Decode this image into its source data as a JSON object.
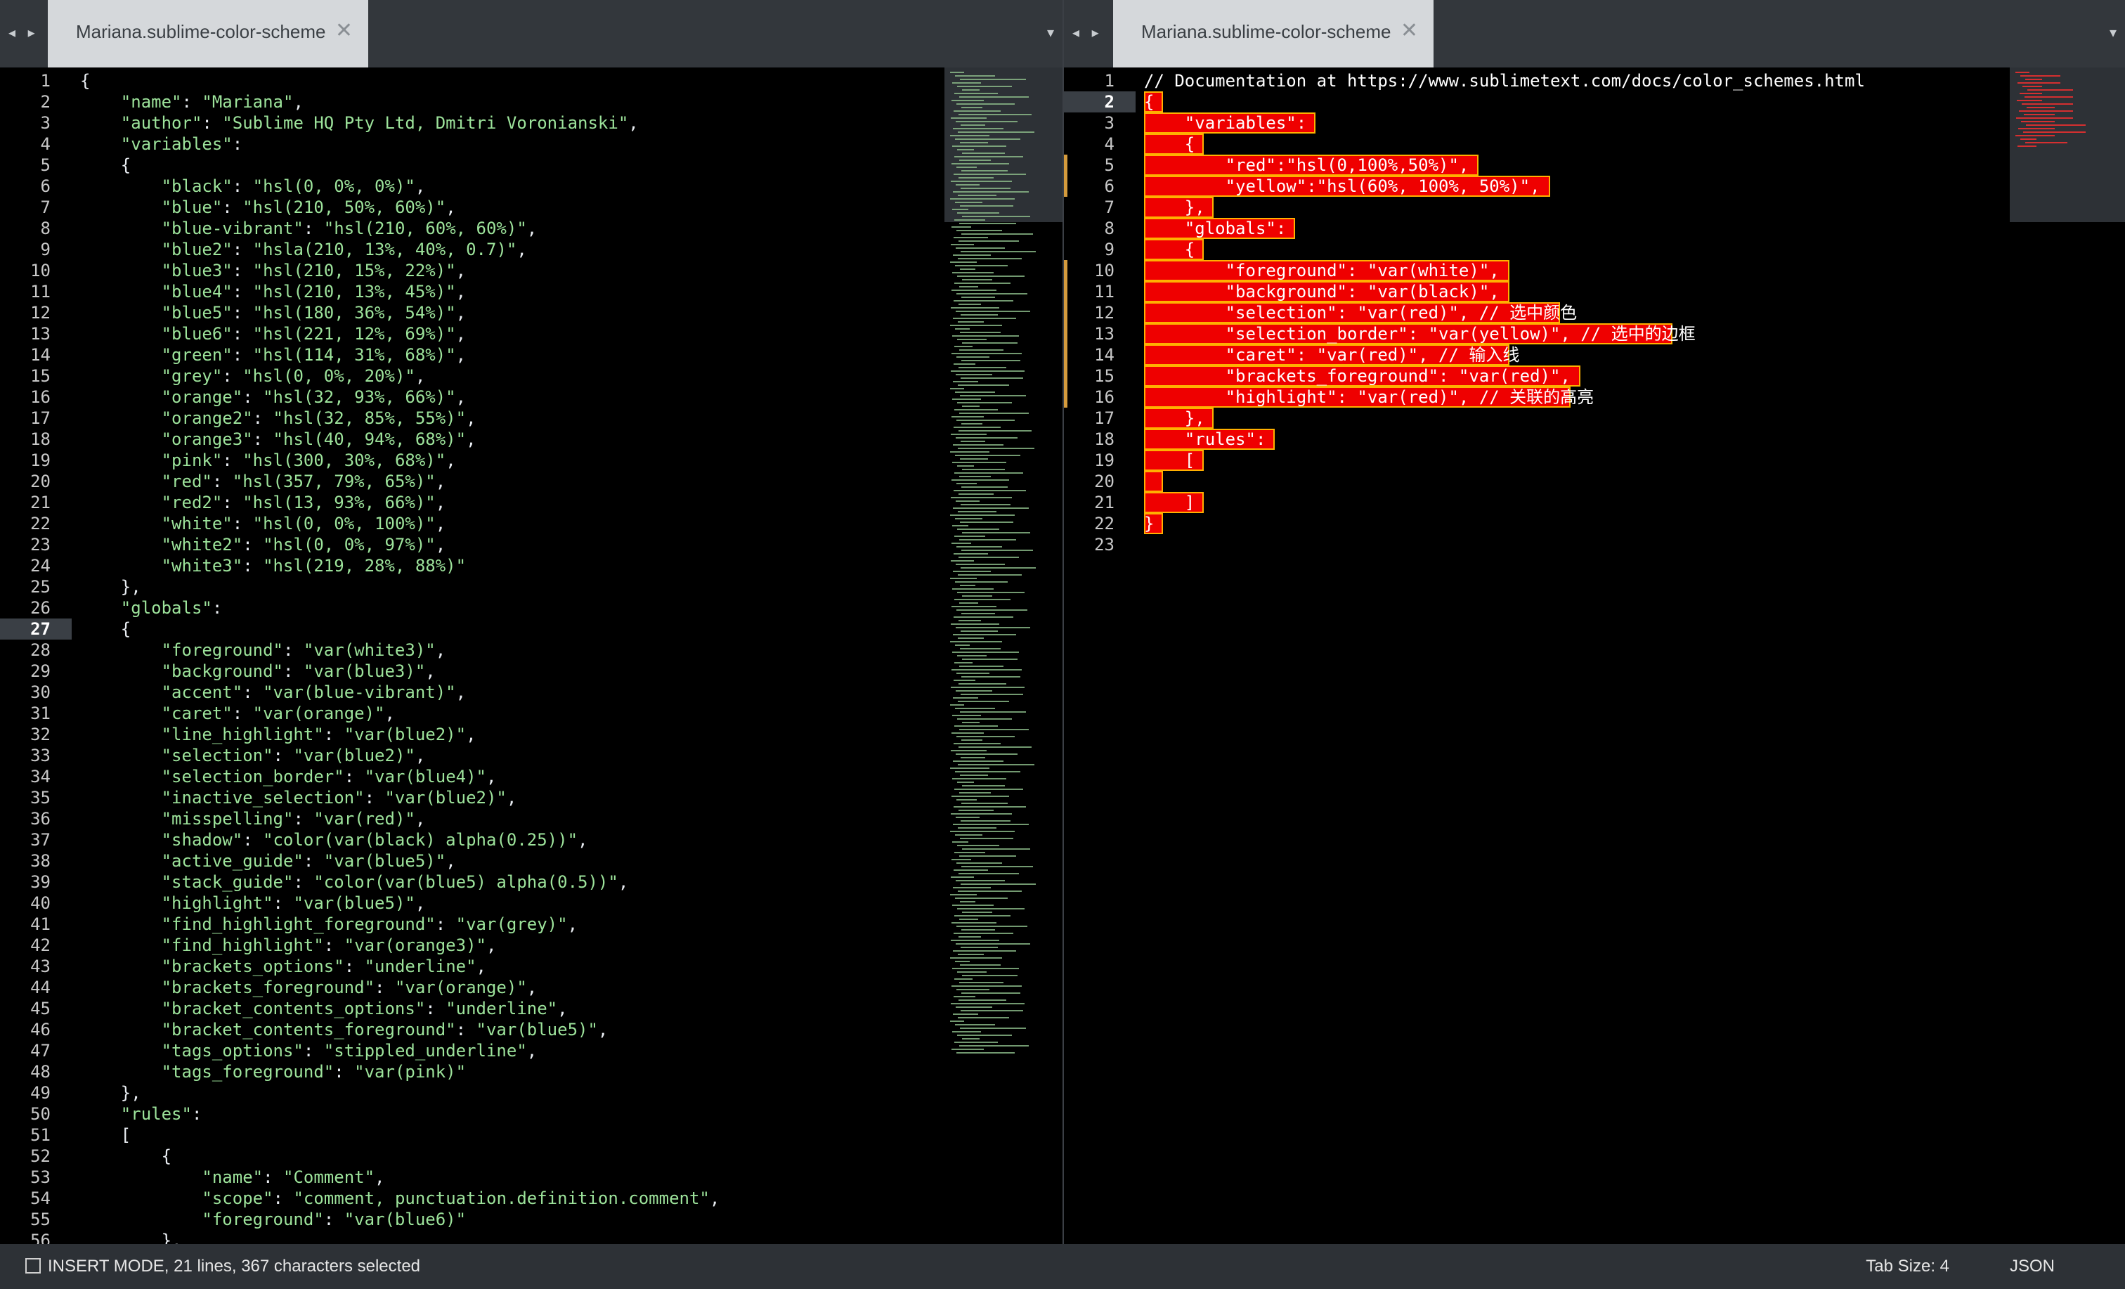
{
  "tab_title": "Mariana.sublime-color-scheme",
  "left_code": [
    {
      "n": "1",
      "t": "{"
    },
    {
      "n": "2",
      "t": "    \"name\": \"Mariana\","
    },
    {
      "n": "3",
      "t": "    \"author\": \"Sublime HQ Pty Ltd, Dmitri Voronianski\","
    },
    {
      "n": "4",
      "t": "    \"variables\":"
    },
    {
      "n": "5",
      "t": "    {"
    },
    {
      "n": "6",
      "t": "        \"black\": \"hsl(0, 0%, 0%)\","
    },
    {
      "n": "7",
      "t": "        \"blue\": \"hsl(210, 50%, 60%)\","
    },
    {
      "n": "8",
      "t": "        \"blue-vibrant\": \"hsl(210, 60%, 60%)\","
    },
    {
      "n": "9",
      "t": "        \"blue2\": \"hsla(210, 13%, 40%, 0.7)\","
    },
    {
      "n": "10",
      "t": "        \"blue3\": \"hsl(210, 15%, 22%)\","
    },
    {
      "n": "11",
      "t": "        \"blue4\": \"hsl(210, 13%, 45%)\","
    },
    {
      "n": "12",
      "t": "        \"blue5\": \"hsl(180, 36%, 54%)\","
    },
    {
      "n": "13",
      "t": "        \"blue6\": \"hsl(221, 12%, 69%)\","
    },
    {
      "n": "14",
      "t": "        \"green\": \"hsl(114, 31%, 68%)\","
    },
    {
      "n": "15",
      "t": "        \"grey\": \"hsl(0, 0%, 20%)\","
    },
    {
      "n": "16",
      "t": "        \"orange\": \"hsl(32, 93%, 66%)\","
    },
    {
      "n": "17",
      "t": "        \"orange2\": \"hsl(32, 85%, 55%)\","
    },
    {
      "n": "18",
      "t": "        \"orange3\": \"hsl(40, 94%, 68%)\","
    },
    {
      "n": "19",
      "t": "        \"pink\": \"hsl(300, 30%, 68%)\","
    },
    {
      "n": "20",
      "t": "        \"red\": \"hsl(357, 79%, 65%)\","
    },
    {
      "n": "21",
      "t": "        \"red2\": \"hsl(13, 93%, 66%)\","
    },
    {
      "n": "22",
      "t": "        \"white\": \"hsl(0, 0%, 100%)\","
    },
    {
      "n": "23",
      "t": "        \"white2\": \"hsl(0, 0%, 97%)\","
    },
    {
      "n": "24",
      "t": "        \"white3\": \"hsl(219, 28%, 88%)\""
    },
    {
      "n": "25",
      "t": "    },"
    },
    {
      "n": "26",
      "t": "    \"globals\":"
    },
    {
      "n": "27",
      "t": "    {"
    },
    {
      "n": "28",
      "t": "        \"foreground\": \"var(white3)\","
    },
    {
      "n": "29",
      "t": "        \"background\": \"var(blue3)\","
    },
    {
      "n": "30",
      "t": "        \"accent\": \"var(blue-vibrant)\","
    },
    {
      "n": "31",
      "t": "        \"caret\": \"var(orange)\","
    },
    {
      "n": "32",
      "t": "        \"line_highlight\": \"var(blue2)\","
    },
    {
      "n": "33",
      "t": "        \"selection\": \"var(blue2)\","
    },
    {
      "n": "34",
      "t": "        \"selection_border\": \"var(blue4)\","
    },
    {
      "n": "35",
      "t": "        \"inactive_selection\": \"var(blue2)\","
    },
    {
      "n": "36",
      "t": "        \"misspelling\": \"var(red)\","
    },
    {
      "n": "37",
      "t": "        \"shadow\": \"color(var(black) alpha(0.25))\","
    },
    {
      "n": "38",
      "t": "        \"active_guide\": \"var(blue5)\","
    },
    {
      "n": "39",
      "t": "        \"stack_guide\": \"color(var(blue5) alpha(0.5))\","
    },
    {
      "n": "40",
      "t": "        \"highlight\": \"var(blue5)\","
    },
    {
      "n": "41",
      "t": "        \"find_highlight_foreground\": \"var(grey)\","
    },
    {
      "n": "42",
      "t": "        \"find_highlight\": \"var(orange3)\","
    },
    {
      "n": "43",
      "t": "        \"brackets_options\": \"underline\","
    },
    {
      "n": "44",
      "t": "        \"brackets_foreground\": \"var(orange)\","
    },
    {
      "n": "45",
      "t": "        \"bracket_contents_options\": \"underline\","
    },
    {
      "n": "46",
      "t": "        \"bracket_contents_foreground\": \"var(blue5)\","
    },
    {
      "n": "47",
      "t": "        \"tags_options\": \"stippled_underline\","
    },
    {
      "n": "48",
      "t": "        \"tags_foreground\": \"var(pink)\""
    },
    {
      "n": "49",
      "t": "    },"
    },
    {
      "n": "50",
      "t": "    \"rules\":"
    },
    {
      "n": "51",
      "t": "    ["
    },
    {
      "n": "52",
      "t": "        {"
    },
    {
      "n": "53",
      "t": "            \"name\": \"Comment\","
    },
    {
      "n": "54",
      "t": "            \"scope\": \"comment, punctuation.definition.comment\","
    },
    {
      "n": "55",
      "t": "            \"foreground\": \"var(blue6)\""
    },
    {
      "n": "56",
      "t": "        },"
    }
  ],
  "right_code": [
    {
      "n": "1",
      "t": "// Documentation at https://www.sublimetext.com/docs/color_schemes.html"
    },
    {
      "n": "2",
      "t": "{"
    },
    {
      "n": "3",
      "t": "    \"variables\":"
    },
    {
      "n": "4",
      "t": "    {"
    },
    {
      "n": "5",
      "t": "        \"red\":\"hsl(0,100%,50%)\","
    },
    {
      "n": "6",
      "t": "        \"yellow\":\"hsl(60%, 100%, 50%)\","
    },
    {
      "n": "7",
      "t": "    },"
    },
    {
      "n": "8",
      "t": "    \"globals\":"
    },
    {
      "n": "9",
      "t": "    {"
    },
    {
      "n": "10",
      "t": "        \"foreground\": \"var(white)\","
    },
    {
      "n": "11",
      "t": "        \"background\": \"var(black)\","
    },
    {
      "n": "12",
      "t": "        \"selection\": \"var(red)\", // 选中颜色"
    },
    {
      "n": "13",
      "t": "        \"selection_border\": \"var(yellow)\", // 选中的边框"
    },
    {
      "n": "14",
      "t": "        \"caret\": \"var(red)\", // 输入线"
    },
    {
      "n": "15",
      "t": "        \"brackets_foreground\": \"var(red)\","
    },
    {
      "n": "16",
      "t": "        \"highlight\": \"var(red)\", // 关联的高亮"
    },
    {
      "n": "17",
      "t": "    },"
    },
    {
      "n": "18",
      "t": "    \"rules\":"
    },
    {
      "n": "19",
      "t": "    ["
    },
    {
      "n": "20",
      "t": ""
    },
    {
      "n": "21",
      "t": "    ]"
    },
    {
      "n": "22",
      "t": "}"
    },
    {
      "n": "23",
      "t": ""
    }
  ],
  "status": {
    "mode_text": "INSERT MODE, 21 lines, 367 characters selected",
    "tab_size": "Tab Size: 4",
    "syntax": "JSON"
  },
  "colors": {
    "selection": "#ef0000",
    "selection_border": "#ffb000",
    "string": "#9de39b",
    "gutter_mark": "#d59b3d"
  },
  "icons": {
    "tab_arrows": "chevron-left-right-icon",
    "tab_close": "close-icon",
    "dropdown": "chevron-down-icon",
    "status_panel": "panel-toggle-icon"
  }
}
